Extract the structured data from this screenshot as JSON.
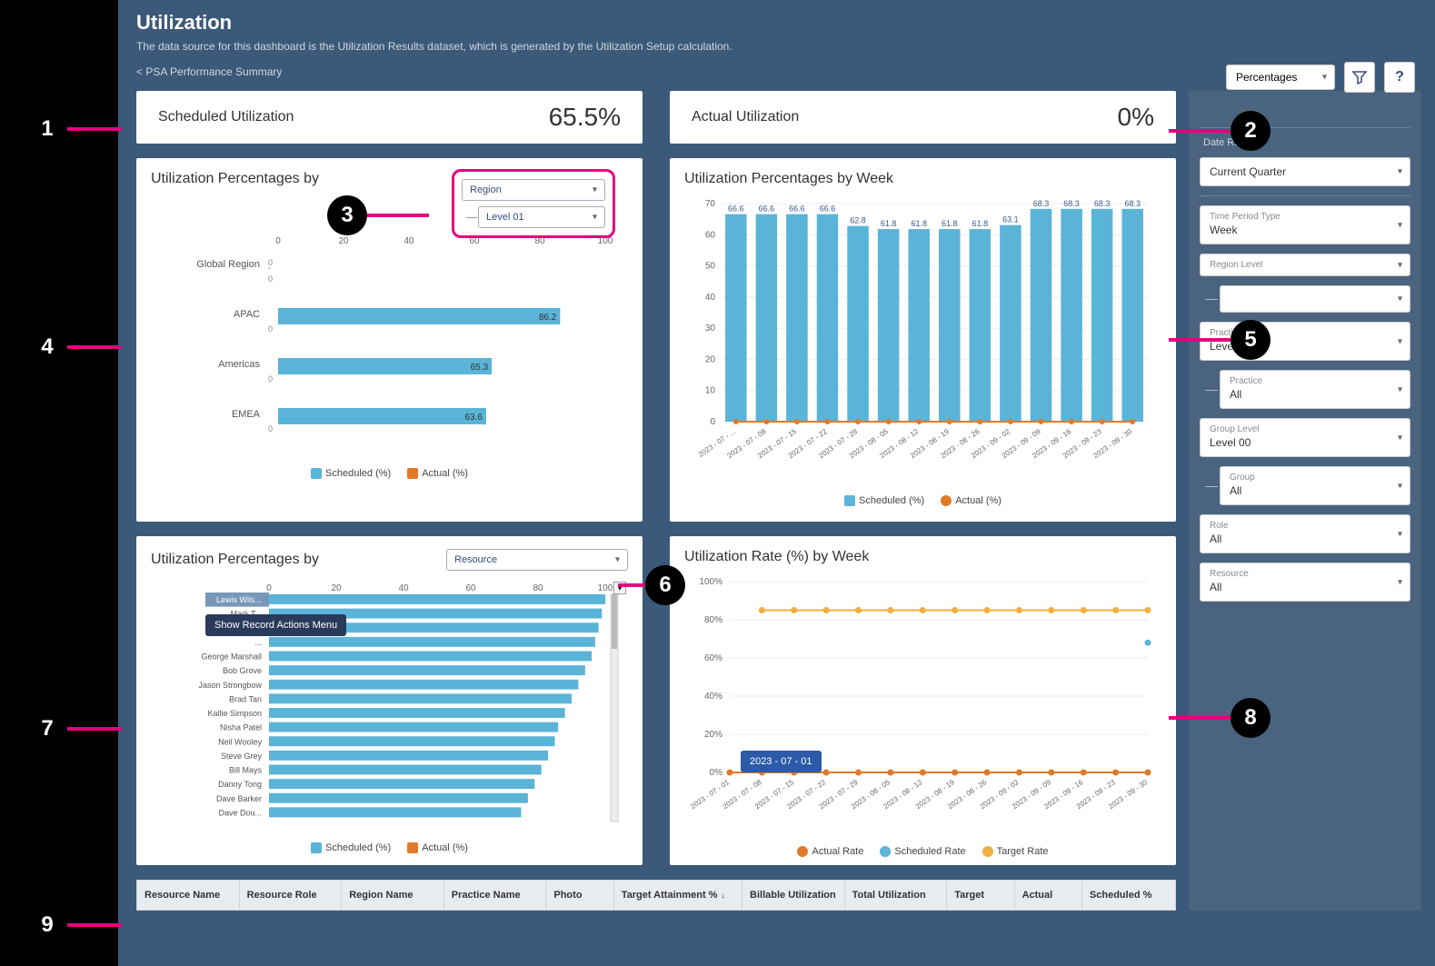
{
  "header": {
    "title": "Utilization",
    "subtitle": "The data source for this dashboard is the Utilization Results dataset, which is generated by the Utilization Setup calculation.",
    "breadcrumb": "< PSA Performance Summary"
  },
  "toolbar": {
    "view_select": "Percentages",
    "filter_tooltip": "Filter",
    "help_tooltip": "?"
  },
  "kpis": {
    "scheduled_label": "Scheduled Utilization",
    "scheduled_value": "65.5%",
    "actual_label": "Actual Utilization",
    "actual_value": "0%"
  },
  "card_region": {
    "title": "Utilization Percentages by",
    "dd1": "Region",
    "dd2": "Level 01",
    "legend_scheduled": "Scheduled (%)",
    "legend_actual": "Actual (%)"
  },
  "card_week": {
    "title": "Utilization Percentages by Week",
    "legend_scheduled": "Scheduled (%)",
    "legend_actual": "Actual (%)"
  },
  "card_resource": {
    "title": "Utilization Percentages by",
    "dd": "Resource",
    "tooltip": "Show Record Actions Menu",
    "legend_scheduled": "Scheduled (%)",
    "legend_actual": "Actual (%)"
  },
  "card_rate": {
    "title": "Utilization Rate (%) by Week",
    "tooltip": "2023 - 07 - 01",
    "legend_actual": "Actual Rate",
    "legend_scheduled": "Scheduled Rate",
    "legend_target": "Target Rate"
  },
  "filters": {
    "date_range_label": "Date Range",
    "date_range_value": "Current Quarter",
    "time_period_label": "Time Period Type",
    "time_period_value": "Week",
    "region_level_label": "Region Level",
    "region_level_value": "",
    "region_sub_value": "",
    "practice_level_label": "Practice Level",
    "practice_level_value": "Level 00",
    "practice_label": "Practice",
    "practice_value": "All",
    "group_level_label": "Group Level",
    "group_level_value": "Level 00",
    "group_label": "Group",
    "group_value": "All",
    "role_label": "Role",
    "role_value": "All",
    "resource_label": "Resource",
    "resource_value": "All"
  },
  "table": {
    "col_resource_name": "Resource Name",
    "col_resource_role": "Resource Role",
    "col_region_name": "Region Name",
    "col_practice_name": "Practice Name",
    "col_photo": "Photo",
    "col_target_attainment": "Target Attainment %",
    "col_billable": "Billable Utilization",
    "col_total": "Total Utilization",
    "col_target": "Target",
    "col_actual": "Actual",
    "col_scheduled": "Scheduled %"
  },
  "callouts": [
    "1",
    "2",
    "3",
    "4",
    "5",
    "6",
    "7",
    "8",
    "9"
  ],
  "chart_data": [
    {
      "id": "utilization_by_region",
      "type": "bar",
      "orientation": "horizontal",
      "title": "Utilization Percentages by Region",
      "xlabel": "",
      "ylabel": "",
      "xlim": [
        0,
        100
      ],
      "x_ticks": [
        0,
        20,
        40,
        60,
        80,
        100
      ],
      "categories": [
        "Global Region",
        "APAC",
        "Americas",
        "EMEA"
      ],
      "series": [
        {
          "name": "Scheduled (%)",
          "color": "#5ab4d8",
          "values": [
            0,
            86.2,
            65.3,
            63.6
          ]
        },
        {
          "name": "Actual (%)",
          "color": "#e07a2a",
          "values": [
            0,
            0,
            0,
            0
          ]
        }
      ]
    },
    {
      "id": "utilization_by_week",
      "type": "bar",
      "title": "Utilization Percentages by Week",
      "ylim": [
        0,
        70
      ],
      "y_ticks": [
        0,
        10,
        20,
        30,
        40,
        50,
        60,
        70
      ],
      "categories": [
        "2023 - 07 - ...",
        "2023 - 07 - 08",
        "2023 - 07 - 15",
        "2023 - 07 - 22",
        "2023 - 07 - 29",
        "2023 - 08 - 05",
        "2023 - 08 - 12",
        "2023 - 08 - 19",
        "2023 - 08 - 26",
        "2023 - 09 - 02",
        "2023 - 09 - 09",
        "2023 - 09 - 16",
        "2023 - 09 - 23",
        "2023 - 09 - 30"
      ],
      "series": [
        {
          "name": "Scheduled (%)",
          "color": "#5ab4d8",
          "values": [
            66.6,
            66.6,
            66.6,
            66.6,
            62.8,
            61.8,
            61.8,
            61.8,
            61.8,
            63.1,
            68.3,
            68.3,
            68.3,
            68.3
          ]
        },
        {
          "name": "Actual (%)",
          "color": "#e07a2a",
          "values": [
            0,
            0,
            0,
            0,
            0,
            0,
            0,
            0,
            0,
            0,
            0,
            0,
            0,
            0
          ]
        }
      ]
    },
    {
      "id": "utilization_by_resource",
      "type": "bar",
      "orientation": "horizontal",
      "title": "Utilization Percentages by Resource",
      "xlim": [
        0,
        100
      ],
      "x_ticks": [
        0,
        20,
        40,
        60,
        80,
        100
      ],
      "categories": [
        "Lewis Wils...",
        "Mark T...",
        "S...",
        "...",
        "George Marshall",
        "Bob Grove",
        "Jason Strongbow",
        "Brad Tan",
        "Kallie Simpson",
        "Nisha Patel",
        "Neil Wooley",
        "Steve Grey",
        "Bill Mays",
        "Danny Tong",
        "Dave Barker",
        "Dave Dou..."
      ],
      "series": [
        {
          "name": "Scheduled (%)",
          "color": "#5ab4d8",
          "values": [
            100,
            99,
            98,
            97,
            96,
            94,
            92,
            90,
            88,
            86,
            85,
            83,
            81,
            79,
            77,
            75
          ]
        },
        {
          "name": "Actual (%)",
          "color": "#e07a2a",
          "values": [
            0,
            0,
            0,
            0,
            0,
            0,
            0,
            0,
            0,
            0,
            0,
            0,
            0,
            0,
            0,
            0
          ]
        }
      ]
    },
    {
      "id": "utilization_rate_by_week",
      "type": "line",
      "title": "Utilization Rate (%) by Week",
      "ylim": [
        0,
        100
      ],
      "y_ticks": [
        0,
        20,
        40,
        60,
        80,
        100
      ],
      "y_tick_labels": [
        "0%",
        "20%",
        "40%",
        "60%",
        "80%",
        "100%"
      ],
      "x": [
        "2023 - 07 - 01",
        "2023 - 07 - 08",
        "2023 - 07 - 15",
        "2023 - 07 - 22",
        "2023 - 07 - 29",
        "2023 - 08 - 05",
        "2023 - 08 - 12",
        "2023 - 08 - 19",
        "2023 - 08 - 26",
        "2023 - 09 - 02",
        "2023 - 09 - 09",
        "2023 - 09 - 16",
        "2023 - 09 - 23",
        "2023 - 09 - 30"
      ],
      "series": [
        {
          "name": "Actual Rate",
          "color": "#e07a2a",
          "values": [
            0,
            0,
            0,
            0,
            0,
            0,
            0,
            0,
            0,
            0,
            0,
            0,
            0,
            0
          ]
        },
        {
          "name": "Scheduled Rate",
          "color": "#5ab4d8",
          "values": [
            null,
            null,
            null,
            null,
            null,
            null,
            null,
            null,
            null,
            null,
            null,
            null,
            null,
            68
          ]
        },
        {
          "name": "Target Rate",
          "color": "#f0b040",
          "values": [
            null,
            85,
            85,
            85,
            85,
            85,
            85,
            85,
            85,
            85,
            85,
            85,
            85,
            85
          ]
        }
      ]
    }
  ]
}
